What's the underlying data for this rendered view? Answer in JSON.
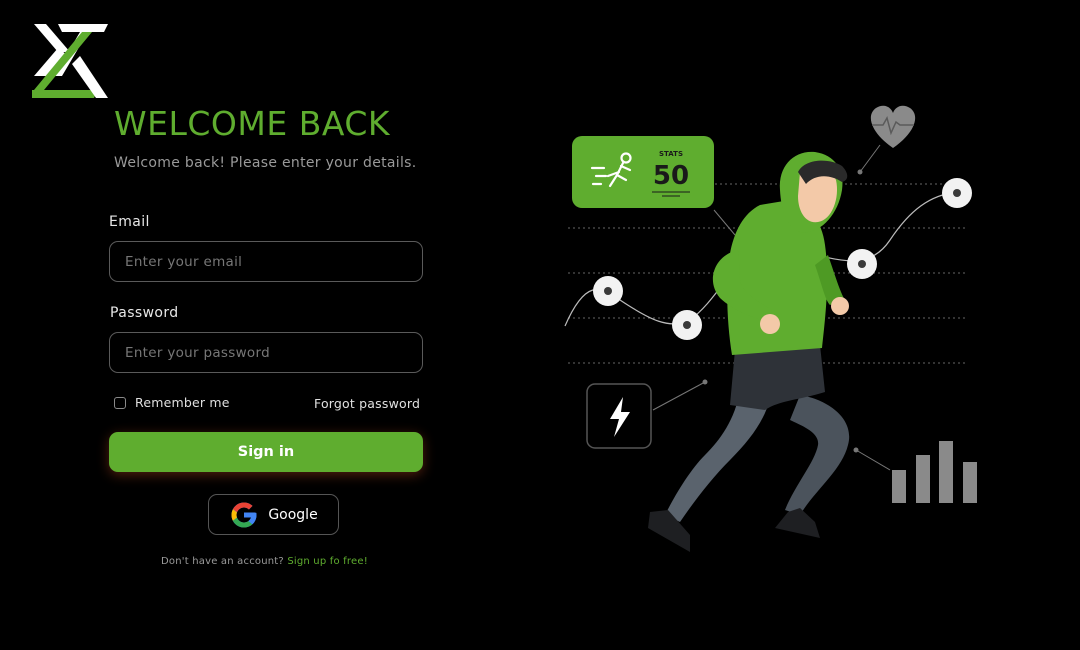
{
  "brand": {
    "logo_icon": "tk-logo-icon",
    "accent": "#5fad2f"
  },
  "header": {
    "title": "WELCOME BACK",
    "subtitle": "Welcome back! Please enter your details."
  },
  "form": {
    "email_label": "Email",
    "email_placeholder": "Enter your email",
    "password_label": "Password",
    "password_placeholder": "Enter your password",
    "remember_label": "Remember me",
    "remember_checked": false,
    "forgot_label": "Forgot password",
    "signin_label": "Sign in",
    "google_label": "Google"
  },
  "footer": {
    "prompt": "Don't have an account?",
    "signup_label": "Sign up fo free!"
  },
  "illustration": {
    "stats_caption": "STATS",
    "stats_value": "50",
    "icons": [
      "runner-icon",
      "heart-icon",
      "lightning-icon",
      "bar-chart-icon"
    ]
  }
}
